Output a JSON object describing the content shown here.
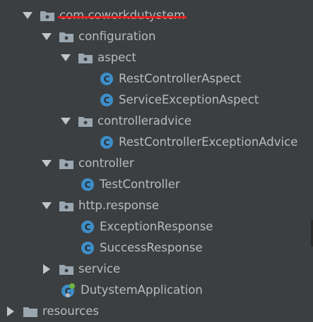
{
  "tree": {
    "root_package": {
      "label": "com.coworkdutystem",
      "redacted": true
    },
    "items": [
      {
        "label": "configuration",
        "type": "package",
        "state": "expanded"
      },
      {
        "label": "aspect",
        "type": "package",
        "state": "expanded"
      },
      {
        "label": "RestControllerAspect",
        "type": "class"
      },
      {
        "label": "ServiceExceptionAspect",
        "type": "class"
      },
      {
        "label": "controlleradvice",
        "type": "package",
        "state": "expanded"
      },
      {
        "label": "RestControllerExceptionAdvice",
        "type": "class"
      },
      {
        "label": "controller",
        "type": "package",
        "state": "expanded"
      },
      {
        "label": "TestController",
        "type": "class"
      },
      {
        "label": "http.response",
        "type": "package",
        "state": "expanded"
      },
      {
        "label": "ExceptionResponse",
        "type": "class"
      },
      {
        "label": "SuccessResponse",
        "type": "class"
      },
      {
        "label": "service",
        "type": "package",
        "state": "collapsed"
      },
      {
        "label": "DutystemApplication",
        "type": "spring-application"
      },
      {
        "label": "resources",
        "type": "folder",
        "state": "collapsed"
      }
    ]
  },
  "colors": {
    "background": "#3c3f41",
    "text": "#bbbbbb",
    "arrow": "#c5c5c5",
    "folder": "#9aa7b0",
    "class_icon": "#3d8ec9",
    "redaction": "#e62020",
    "spring": "#6db33f"
  },
  "icons": {
    "expanded": "triangle-down-icon",
    "collapsed": "triangle-right-icon",
    "package": "package-folder-icon",
    "class": "java-class-icon",
    "spring-application": "spring-boot-application-icon"
  }
}
